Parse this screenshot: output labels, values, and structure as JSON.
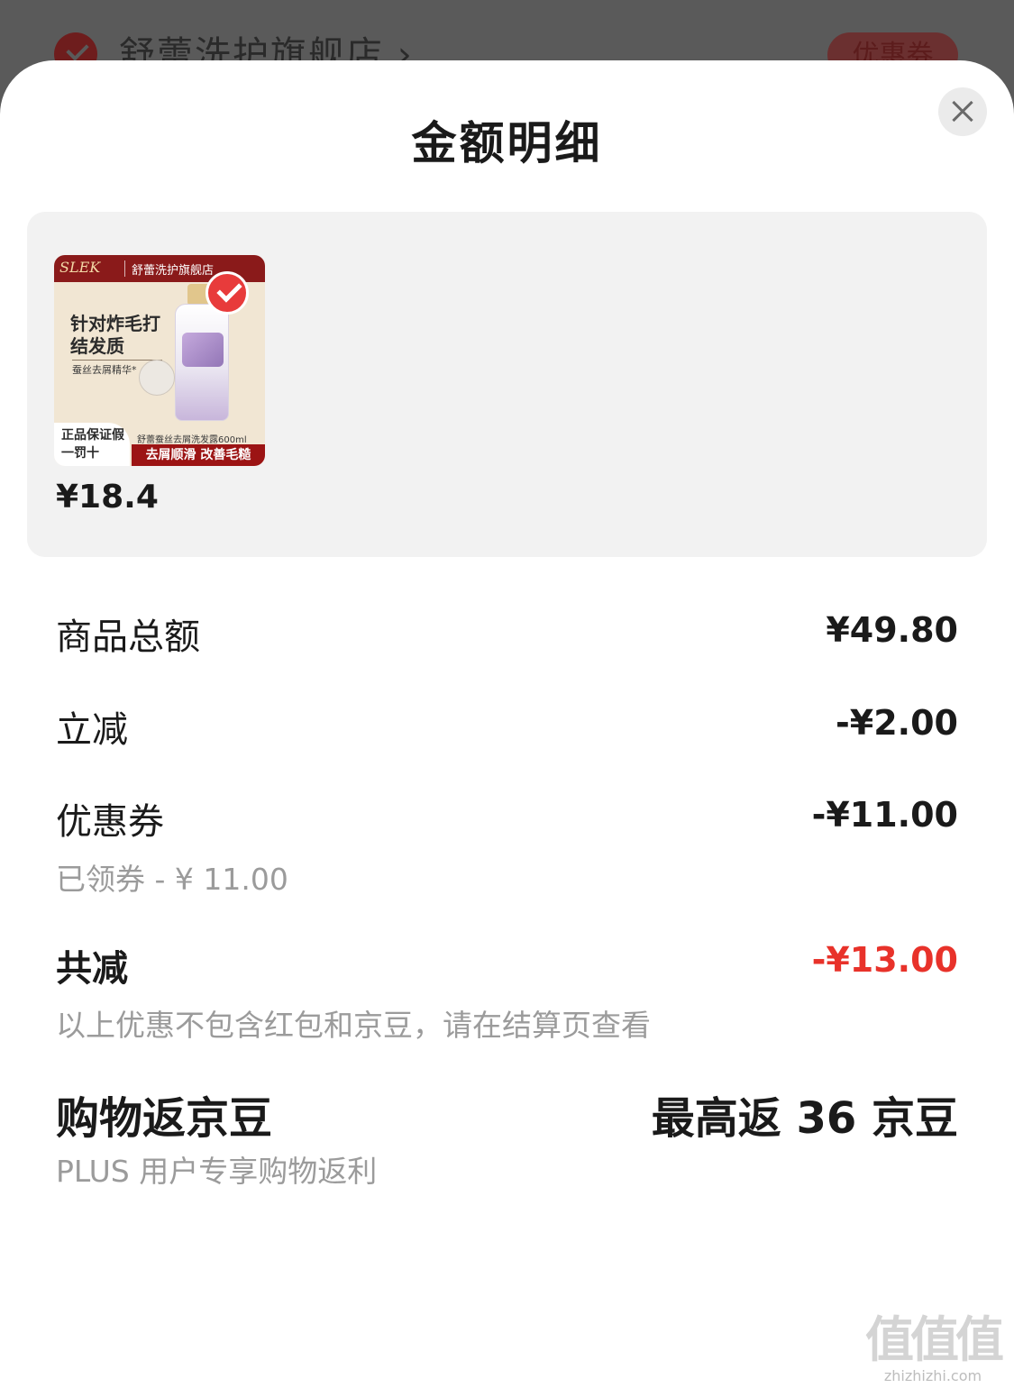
{
  "background": {
    "store_name": "舒蕾洗护旗舰店 ›",
    "coupon_label": "优惠券"
  },
  "sheet": {
    "title": "金额明细",
    "close_icon": "close-icon"
  },
  "product": {
    "image": {
      "brand": "SLEK",
      "store": "舒蕾洗护旗舰店",
      "headline": "针对炸毛打结发质",
      "subline": "蚕丝去屑精华*",
      "badge": "正品保证假一罚十",
      "caption": "舒蕾蚕丝去屑洗发露600ml",
      "footer": "去屑顺滑 改善毛糙"
    },
    "selected": true,
    "price": "¥18.4"
  },
  "breakdown": {
    "total_label": "商品总额",
    "total_value": "¥49.80",
    "instant_label": "立减",
    "instant_value": "-¥2.00",
    "coupon_label": "优惠券",
    "coupon_value": "-¥11.00",
    "coupon_note": "已领券 - ¥ 11.00",
    "sum_label": "共减",
    "sum_value": "-¥13.00",
    "sum_note": "以上优惠不包含红包和京豆，请在结算页查看"
  },
  "rewards": {
    "label": "购物返京豆",
    "value": "最高返 36 京豆",
    "note": "PLUS 用户专享购物返利"
  },
  "watermark": {
    "mark": "值值值",
    "url": "zhizhizhi.com"
  },
  "colors": {
    "accent": "#e8322a",
    "muted": "#9b9b9b",
    "card_bg": "#f2f2f2"
  }
}
